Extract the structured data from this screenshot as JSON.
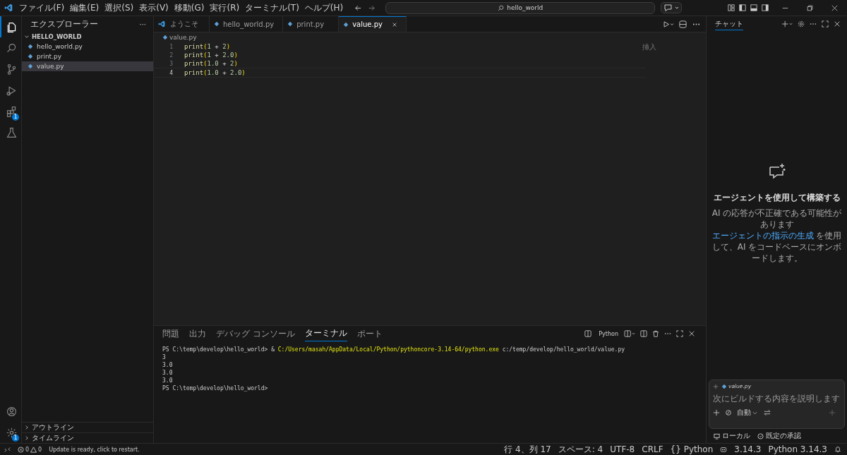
{
  "menu": [
    "ファイル(F)",
    "編集(E)",
    "選択(S)",
    "表示(V)",
    "移動(G)",
    "実行(R)",
    "ターミナル(T)",
    "ヘルプ(H)"
  ],
  "search": {
    "value": "hello_world"
  },
  "activity": [
    {
      "kind": "files",
      "selected": true
    },
    {
      "kind": "search",
      "selected": false
    },
    {
      "kind": "scm",
      "selected": false
    },
    {
      "kind": "run",
      "selected": false
    },
    {
      "kind": "extensions",
      "selected": false,
      "badge": "1"
    },
    {
      "kind": "test",
      "selected": false
    }
  ],
  "activity_bottom": [
    {
      "kind": "account"
    },
    {
      "kind": "settings",
      "badge": "1"
    }
  ],
  "sidebar": {
    "title": "エクスプローラー",
    "more": "···",
    "folder": "HELLO_WORLD",
    "expanded": true,
    "files": [
      {
        "name": "hello_world.py",
        "selected": false
      },
      {
        "name": "print.py",
        "selected": false
      },
      {
        "name": "value.py",
        "selected": true
      }
    ],
    "sections": [
      "アウトライン",
      "タイムライン"
    ]
  },
  "tabs": [
    {
      "label": "ようこそ",
      "kind": "welcome",
      "selected": false
    },
    {
      "label": "hello_world.py",
      "kind": "py",
      "selected": false
    },
    {
      "label": "print.py",
      "kind": "py",
      "selected": false
    },
    {
      "label": "value.py",
      "kind": "py",
      "selected": true
    }
  ],
  "breadcrumb": "value.py",
  "editor_hint": "挿入",
  "code": [
    {
      "num": "1",
      "current": false,
      "tokens": [
        {
          "t": "print",
          "kind": "fn"
        },
        {
          "t": "(",
          "kind": "paren"
        },
        {
          "t": "1",
          "kind": "num"
        },
        {
          "t": " + ",
          "kind": "op"
        },
        {
          "t": "2",
          "kind": "num"
        },
        {
          "t": ")",
          "kind": "paren"
        }
      ]
    },
    {
      "num": "2",
      "current": false,
      "tokens": [
        {
          "t": "print",
          "kind": "fn"
        },
        {
          "t": "(",
          "kind": "paren"
        },
        {
          "t": "1",
          "kind": "num"
        },
        {
          "t": " + ",
          "kind": "op"
        },
        {
          "t": "2.0",
          "kind": "num"
        },
        {
          "t": ")",
          "kind": "paren"
        }
      ]
    },
    {
      "num": "3",
      "current": false,
      "tokens": [
        {
          "t": "print",
          "kind": "fn"
        },
        {
          "t": "(",
          "kind": "paren"
        },
        {
          "t": "1.0",
          "kind": "num"
        },
        {
          "t": " + ",
          "kind": "op"
        },
        {
          "t": "2",
          "kind": "num"
        },
        {
          "t": ")",
          "kind": "paren"
        }
      ]
    },
    {
      "num": "4",
      "current": true,
      "tokens": [
        {
          "t": "print",
          "kind": "fn"
        },
        {
          "t": "(",
          "kind": "paren"
        },
        {
          "t": "1.0",
          "kind": "num"
        },
        {
          "t": " + ",
          "kind": "op"
        },
        {
          "t": "2.0",
          "kind": "num"
        },
        {
          "t": ")",
          "kind": "paren"
        }
      ]
    }
  ],
  "panel_tabs": [
    {
      "label": "問題",
      "selected": false
    },
    {
      "label": "出力",
      "selected": false
    },
    {
      "label": "デバッグ コンソール",
      "selected": false
    },
    {
      "label": "ターミナル",
      "selected": true
    },
    {
      "label": "ポート",
      "selected": false
    }
  ],
  "terminal_name": "Python",
  "terminal": [
    [
      {
        "t": "PS C:\\temp\\develop\\hello_world> & ",
        "kind": "plain"
      },
      {
        "t": "C:/Users/masah/AppData/Local/Python/pythoncore-3.14-64/python.exe",
        "kind": "exe"
      },
      {
        "t": " c:/temp/develop/hello_world/value.py",
        "kind": "plain"
      }
    ],
    [
      {
        "t": "3",
        "kind": "plain"
      }
    ],
    [
      {
        "t": "3.0",
        "kind": "plain"
      }
    ],
    [
      {
        "t": "3.0",
        "kind": "plain"
      }
    ],
    [
      {
        "t": "3.0",
        "kind": "plain"
      }
    ],
    [
      {
        "t": "PS C:\\temp\\develop\\hello_world>",
        "kind": "plain"
      }
    ]
  ],
  "chat": {
    "tab": "チャット",
    "heading": "エージェントを使用して構築する",
    "line1": "AI の応答が不正確である可能性があります",
    "link": "エージェントの指示の生成",
    "line2": " を使用して、AI をコードベースにオンボードします。",
    "attachment": "value.py",
    "placeholder": "次にビルドする内容を説明します",
    "mode": "自動",
    "target": "ローカル",
    "approval": "既定の承認"
  },
  "status": {
    "errors": "0",
    "warnings": "0",
    "message": "Update is ready, click to restart.",
    "right": [
      "行 4、列 17",
      "スペース: 4",
      "UTF-8",
      "CRLF"
    ],
    "language_icon": "{}",
    "language": "Python",
    "version": "3.14.3",
    "interpreter": "Python 3.14.3"
  }
}
